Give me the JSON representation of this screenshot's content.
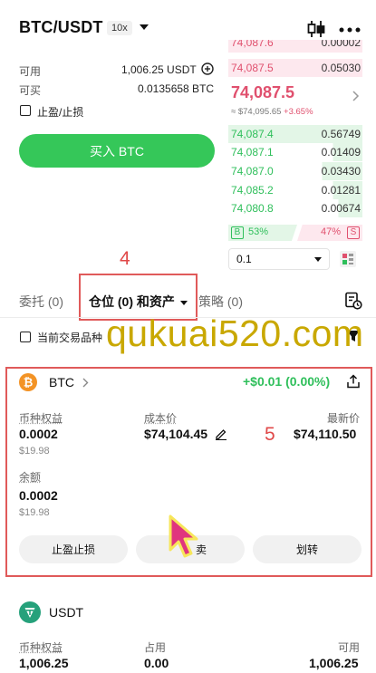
{
  "header": {
    "pair": "BTC/USDT",
    "leverage": "10x"
  },
  "balances": {
    "available_label": "可用",
    "available_value": "1,006.25 USDT",
    "buyable_label": "可买",
    "buyable_value": "0.0135658 BTC",
    "tpsl_label": "止盈/止损"
  },
  "buy_button": "买入 BTC",
  "orderbook": {
    "asks": [
      {
        "price": "74,087.6",
        "amount": "0.00002"
      },
      {
        "price": "74,087.5",
        "amount": "0.05030"
      }
    ],
    "last_price": "74,087.5",
    "sub_price": "≈ $74,095.65",
    "change": "+3.65%",
    "bids": [
      {
        "price": "74,087.4",
        "amount": "0.56749"
      },
      {
        "price": "74,087.1",
        "amount": "0.01409"
      },
      {
        "price": "74,087.0",
        "amount": "0.03430"
      },
      {
        "price": "74,085.2",
        "amount": "0.01281"
      },
      {
        "price": "74,080.8",
        "amount": "0.00674"
      }
    ],
    "buy_ratio_label": "B",
    "buy_ratio": "53%",
    "sell_ratio": "47%",
    "sell_ratio_label": "S",
    "buy_ratio_value": 0.53,
    "depth_select": "0.1"
  },
  "annotations": {
    "step4": "4",
    "step5": "5"
  },
  "tabs": {
    "orders": "委托 (0)",
    "positions": "仓位 (0) 和资产",
    "strategies": "策略 (0)"
  },
  "filter": {
    "current_only": "当前交易品种"
  },
  "watermark": "qukuai520.com",
  "btc_card": {
    "coin": "BTC",
    "pnl": "+$0.01 (0.00%)",
    "equity_label": "币种权益",
    "equity": "0.0002",
    "equity_usd": "$19.98",
    "cost_label": "成本价",
    "cost": "$74,104.45",
    "latest_label": "最新价",
    "latest": "$74,110.50",
    "balance_label": "余额",
    "balance": "0.0002",
    "balance_usd": "$19.98",
    "btn_tpsl": "止盈止损",
    "btn_sell": "卖",
    "btn_transfer": "划转"
  },
  "usdt_card": {
    "coin": "USDT",
    "equity_label": "币种权益",
    "equity": "1,006.25",
    "occupied_label": "占用",
    "occupied": "0.00",
    "available_label": "可用",
    "available": "1,006.25"
  },
  "colors": {
    "green": "#35c759",
    "red": "#e0506e",
    "annotation": "#e05a5a",
    "btc": "#f39325",
    "usdt": "#26a17b"
  }
}
